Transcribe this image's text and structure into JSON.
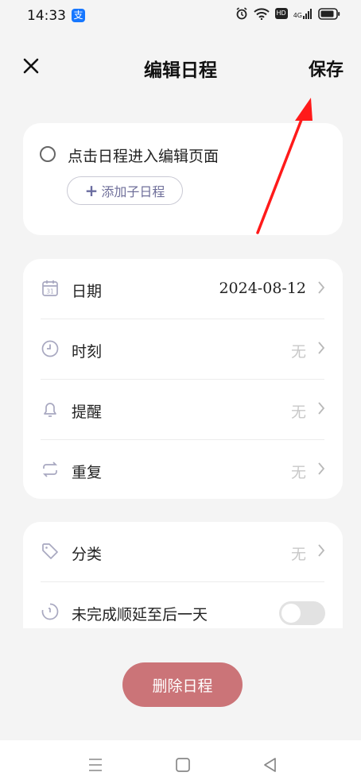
{
  "status_bar": {
    "time": "14:33",
    "app_badge": "支",
    "icons": [
      "alarm-icon",
      "wifi-icon",
      "hd-icon",
      "signal-4g-icon",
      "battery-icon"
    ],
    "hd": "HD",
    "network": "4G"
  },
  "header": {
    "close_icon": "close-icon",
    "title": "编辑日程",
    "save_label": "保存"
  },
  "task": {
    "title": "点击日程进入编辑页面",
    "add_subtask_label": "添加子日程"
  },
  "settings": {
    "rows": [
      {
        "icon": "calendar-icon",
        "label": "日期",
        "value": "2024-08-12"
      },
      {
        "icon": "clock-icon",
        "label": "时刻",
        "value": "无"
      },
      {
        "icon": "bell-icon",
        "label": "提醒",
        "value": "无"
      },
      {
        "icon": "repeat-icon",
        "label": "重复",
        "value": "无"
      }
    ]
  },
  "category": {
    "label": "分类",
    "value": "无",
    "postpone_label": "未完成顺延至后一天",
    "postpone_enabled": false
  },
  "actions": {
    "delete_label": "删除日程"
  },
  "colors": {
    "background": "#f4f4f4",
    "card": "#ffffff",
    "delete_button": "#cb7478",
    "subtask_text": "#6f6f9a",
    "icon_tint": "#a8a8c0"
  }
}
